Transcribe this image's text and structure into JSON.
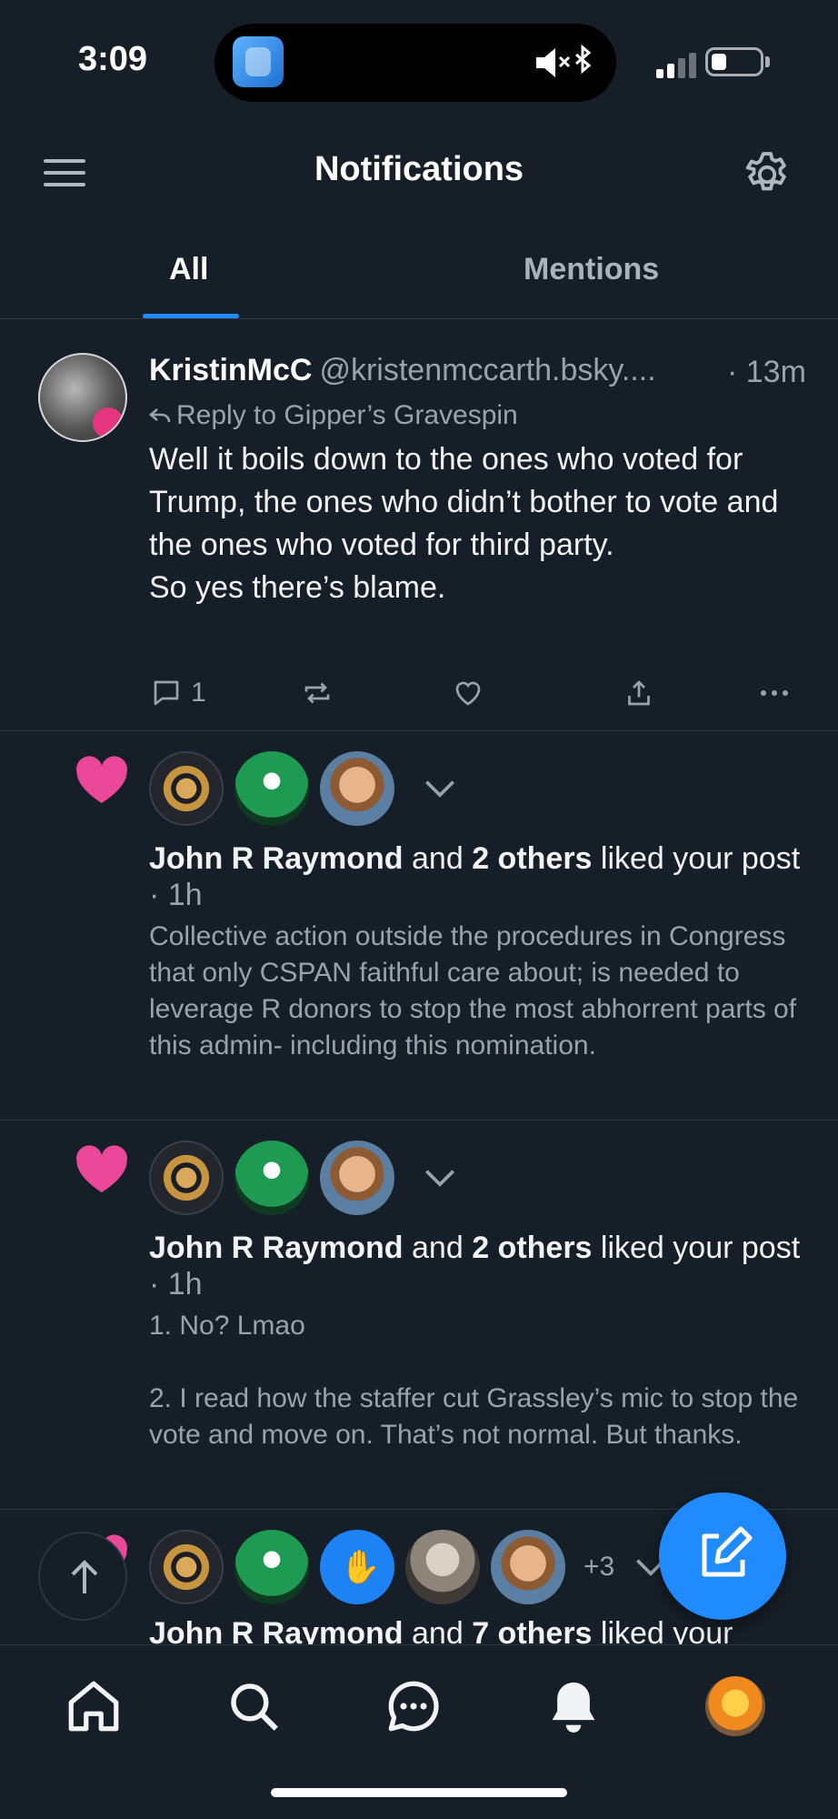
{
  "status_bar": {
    "time": "3:09",
    "battery_level": 0.2
  },
  "header": {
    "title": "Notifications"
  },
  "tabs": [
    {
      "label": "All",
      "selected": true
    },
    {
      "label": "Mentions",
      "selected": false
    }
  ],
  "post": {
    "author": "KristinMcC",
    "handle": "@kristenmccarth.bsky....",
    "time": "· 13m",
    "reply_to": "Reply to Gipper’s Gravespin",
    "body": "Well it boils down to the ones who voted for Trump, the ones who didn’t bother to vote and the ones who voted for third party.\nSo yes there’s blame.",
    "reply_count": "1"
  },
  "notifications": [
    {
      "name": "John R Raymond",
      "and": " and ",
      "others": "2 others",
      "action": " liked your post",
      "ago": " · 1h",
      "snippet": "Collective action outside the procedures in Congress that only CSPAN faithful care about; is needed to leverage R donors to stop the most abhorrent parts of this admin- including this nomination."
    },
    {
      "name": "John R Raymond",
      "and": " and ",
      "others": "2 others",
      "action": " liked your post",
      "ago": " · 1h",
      "snippet": "1. No? Lmao\n\n2. I read how the staffer cut Grassley’s mic to stop the vote and move on. That’s not normal. But thanks."
    },
    {
      "name": "John R Raymond",
      "and": " and ",
      "others": "7 others",
      "action": " liked your",
      "more_count": "+3"
    }
  ],
  "colors": {
    "accent": "#208bfe",
    "like": "#ec4899",
    "background": "#161e27",
    "muted": "#9aa3ad"
  },
  "bottom_nav": [
    "home-icon",
    "search-icon",
    "chat-icon",
    "bell-icon",
    "profile-avatar"
  ]
}
